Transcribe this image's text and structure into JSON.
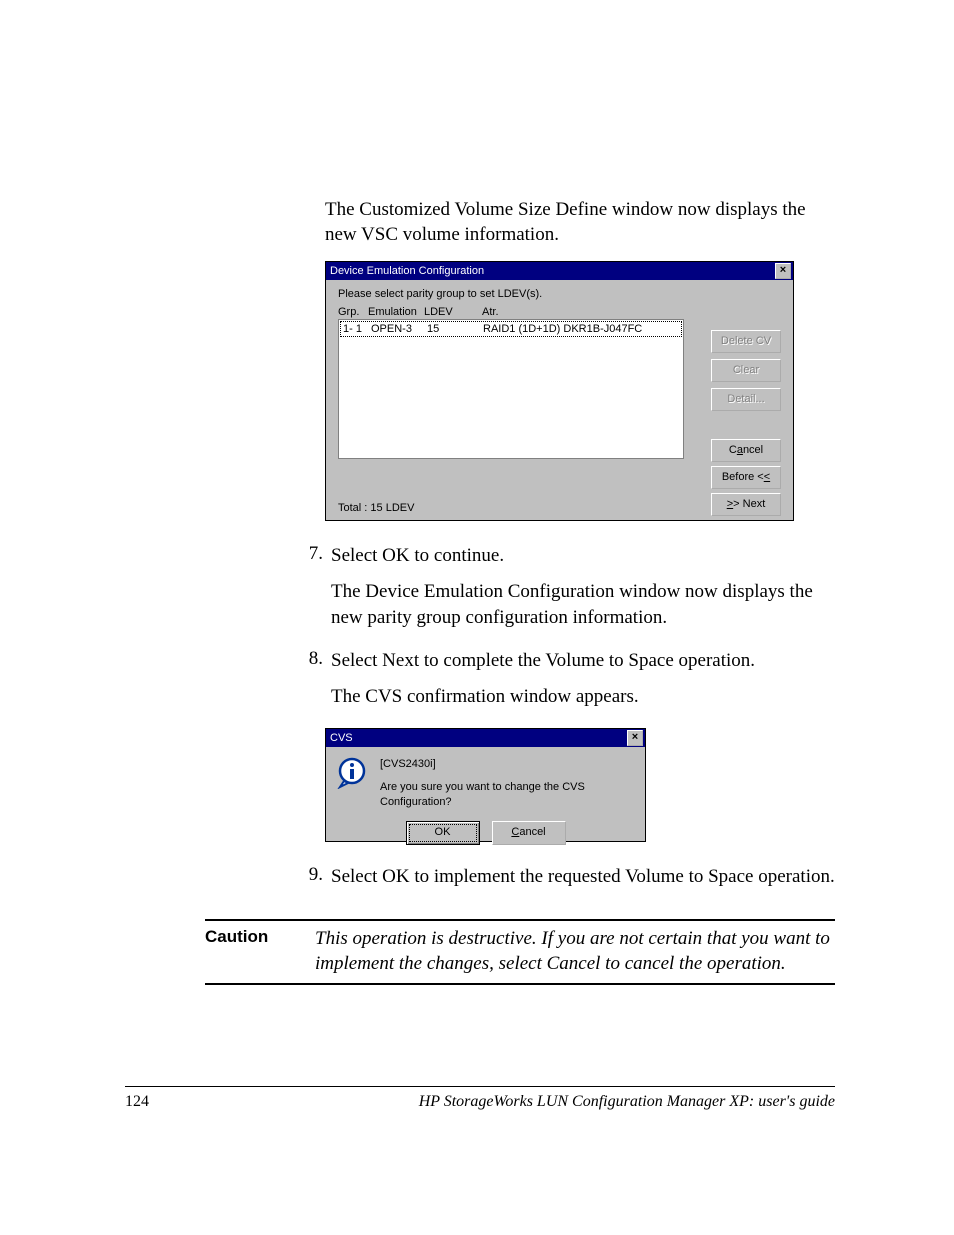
{
  "body": {
    "intro": "The Customized Volume Size Define window now displays the new VSC volume information.",
    "step7_a": "Select OK to continue.",
    "step7_b": "The Device Emulation Configuration window now displays the new parity group configuration information.",
    "step8_a": "Select Next to complete the Volume to Space operation.",
    "step8_b": "The CVS confirmation window appears.",
    "step9": "Select OK to implement the requested Volume to Space operation.",
    "nums": {
      "n7": "7.",
      "n8": "8.",
      "n9": "9."
    }
  },
  "caution": {
    "label": "Caution",
    "text": "This operation is destructive. If you are not certain that you want to implement the changes, select Cancel to cancel the operation."
  },
  "footer": {
    "page": "124",
    "title": "HP StorageWorks LUN Configuration Manager XP: user's guide"
  },
  "win1": {
    "title": "Device Emulation Configuration",
    "close": "×",
    "instruction": "Please select parity group to set LDEV(s).",
    "cols": {
      "grp": "Grp.",
      "emu": "Emulation",
      "ldev": "LDEV",
      "atr": "Atr."
    },
    "row": {
      "grp": "1- 1",
      "emu": "OPEN-3",
      "ldev": "15",
      "atr": "RAID1 (1D+1D)   DKR1B-J047FC"
    },
    "buttons": {
      "delete_cv": "Delete CV",
      "clear": "Clear",
      "detail": "Detail...",
      "cancel_pre": "C",
      "cancel_u": "a",
      "cancel_post": "ncel",
      "before": "Before <",
      "before_u": "<",
      "next_pre": ">",
      "next_u": ">",
      "next_post": " Next"
    },
    "total": "Total : 15 LDEV"
  },
  "win2": {
    "title": "CVS",
    "close": "×",
    "code": "[CVS2430i]",
    "question": "Are you sure you want to change the CVS Configuration?",
    "ok": "OK",
    "cancel_u": "C",
    "cancel_post": "ancel"
  }
}
